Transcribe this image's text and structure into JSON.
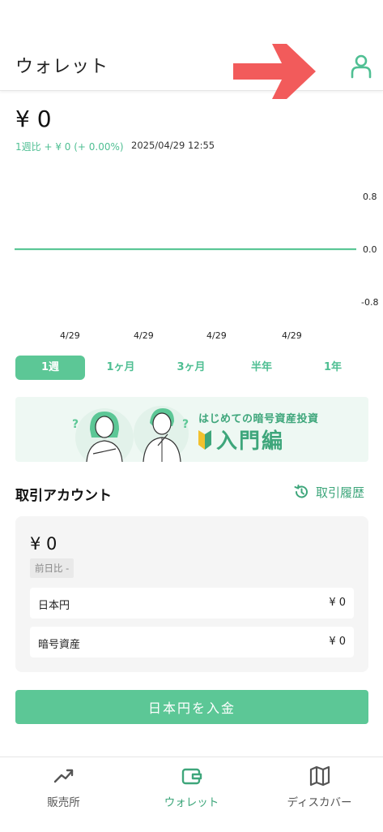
{
  "header": {
    "title": "ウォレット",
    "profile_icon": "person-icon"
  },
  "summary": {
    "balance": "¥ 0",
    "change": "1週比 + ¥ 0 (+ 0.00%)",
    "timestamp": "2025/04/29 12:55"
  },
  "chart_data": {
    "type": "line",
    "x": [
      "4/29",
      "4/29",
      "4/29",
      "4/29"
    ],
    "series": [
      {
        "values": [
          0,
          0,
          0,
          0,
          0
        ]
      }
    ],
    "y_ticks": [
      "0.8",
      "0.0",
      "-0.8"
    ],
    "ylim": [
      -0.8,
      0.8
    ],
    "line_color": "#5cc796",
    "grid": false
  },
  "periods": [
    "1週",
    "1ヶ月",
    "3ヶ月",
    "半年",
    "1年"
  ],
  "active_period": "1週",
  "banner": {
    "subtitle": "はじめての暗号資産投資",
    "title": "入門編"
  },
  "account": {
    "section_title": "取引アカウント",
    "history_label": "取引履歴",
    "balance": "¥ 0",
    "prev_day_badge": "前日比 -",
    "rows": [
      {
        "label": "日本円",
        "value": "¥ 0"
      },
      {
        "label": "暗号資産",
        "value": "¥ 0"
      }
    ]
  },
  "deposit_button": "日本円を入金",
  "nav": [
    {
      "label": "販売所",
      "icon": "trend-up-icon"
    },
    {
      "label": "ウォレット",
      "icon": "wallet-icon"
    },
    {
      "label": "ディスカバー",
      "icon": "map-icon"
    }
  ],
  "colors": {
    "accent": "#5cc796",
    "accent_text": "#3ea67b",
    "arrow": "#f25b5b"
  }
}
